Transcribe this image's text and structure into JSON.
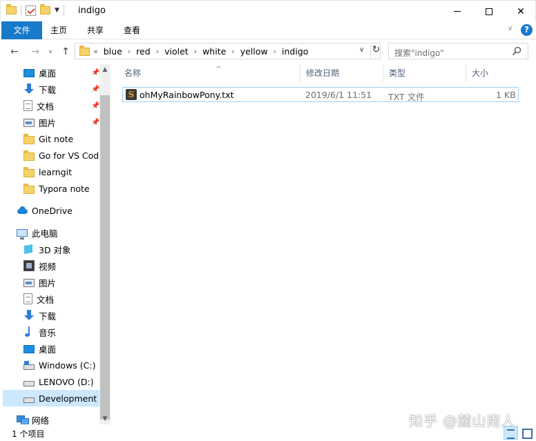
{
  "window": {
    "title": "indigo"
  },
  "ribbon": {
    "tabs": [
      "文件",
      "主页",
      "共享",
      "查看"
    ],
    "help_label": "?"
  },
  "address": {
    "overflow": "«",
    "crumbs": [
      "blue",
      "red",
      "violet",
      "white",
      "yellow",
      "indigo"
    ]
  },
  "search": {
    "placeholder": "搜索\"indigo\""
  },
  "nav_pane": {
    "quick_access": [
      {
        "label": "桌面",
        "icon": "desktop-icon",
        "pinned": true
      },
      {
        "label": "下载",
        "icon": "download-icon",
        "pinned": true
      },
      {
        "label": "文档",
        "icon": "document-icon",
        "pinned": true
      },
      {
        "label": "图片",
        "icon": "picture-icon",
        "pinned": true
      },
      {
        "label": "Git note",
        "icon": "folder-icon",
        "pinned": false
      },
      {
        "label": "Go for VS Cod",
        "icon": "folder-icon",
        "pinned": false
      },
      {
        "label": "learngit",
        "icon": "folder-icon",
        "pinned": false
      },
      {
        "label": "Typora note",
        "icon": "folder-icon",
        "pinned": false
      }
    ],
    "onedrive": "OneDrive",
    "this_pc": "此电脑",
    "pc_items": [
      {
        "label": "3D 对象",
        "icon": "3d-objects-icon"
      },
      {
        "label": "视频",
        "icon": "video-icon"
      },
      {
        "label": "图片",
        "icon": "picture-icon"
      },
      {
        "label": "文档",
        "icon": "document-icon"
      },
      {
        "label": "下载",
        "icon": "download-icon"
      },
      {
        "label": "音乐",
        "icon": "music-icon"
      },
      {
        "label": "桌面",
        "icon": "desktop-icon"
      },
      {
        "label": "Windows (C:)",
        "icon": "windows-drive-icon"
      },
      {
        "label": "LENOVO (D:)",
        "icon": "drive-icon"
      },
      {
        "label": "Development (",
        "icon": "drive-icon",
        "selected": true
      }
    ],
    "network": "网络"
  },
  "file_list": {
    "columns": [
      "名称",
      "修改日期",
      "类型",
      "大小"
    ],
    "rows": [
      {
        "name": "ohMyRainbowPony.txt",
        "modified": "2019/6/1 11:51",
        "type": "TXT 文件",
        "size": "1 KB",
        "icon_glyph": "S"
      }
    ]
  },
  "status": {
    "item_count": "1 个项目"
  },
  "watermark": "知乎 @麓山南人",
  "colors": {
    "accent": "#1979ca",
    "selection": "#cce8ff",
    "folder": "#f6d36a"
  }
}
